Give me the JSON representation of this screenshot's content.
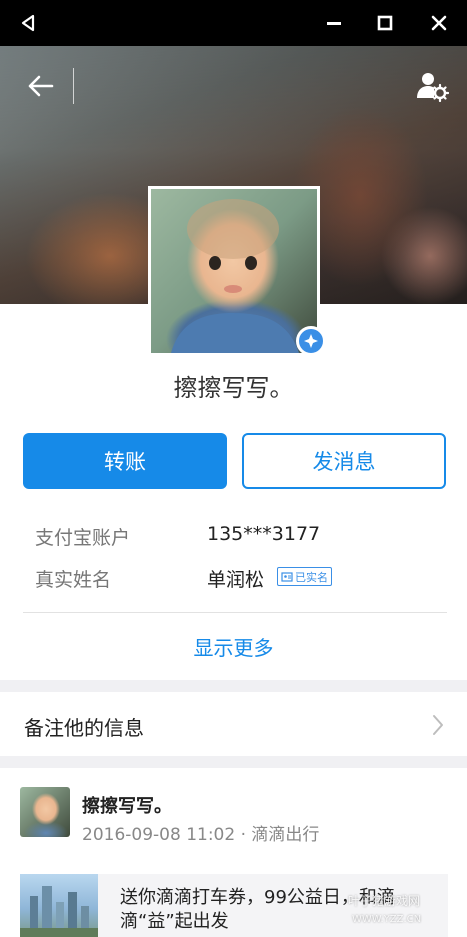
{
  "window": {
    "back_icon": "triangle-back-icon",
    "minimize_icon": "minimize-icon",
    "maximize_icon": "maximize-icon",
    "close_icon": "close-icon"
  },
  "header": {
    "back_icon": "arrow-left-icon",
    "settings_icon": "user-settings-icon"
  },
  "profile": {
    "nickname": "擦擦写写。",
    "verified_icon": "verified-badge-icon"
  },
  "actions": {
    "transfer_label": "转账",
    "message_label": "发消息"
  },
  "info": {
    "account_label": "支付宝账户",
    "account_value": "135***3177",
    "realname_label": "真实姓名",
    "realname_value": "单润松",
    "realname_badge": "已实名"
  },
  "show_more_label": "显示更多",
  "remark": {
    "label": "备注他的信息"
  },
  "feed": {
    "name": "擦擦写写。",
    "meta": "2016-09-08 11:02 · 滴滴出行",
    "share_text": "送你滴滴打车券，99公益日，和滴滴“益”起出发"
  },
  "watermark": {
    "text": "叶子猪游戏网",
    "url": "WWW.YZZ.CN"
  },
  "colors": {
    "accent": "#168ae8",
    "titlebar": "#000000",
    "background": "#f0f0f3"
  }
}
